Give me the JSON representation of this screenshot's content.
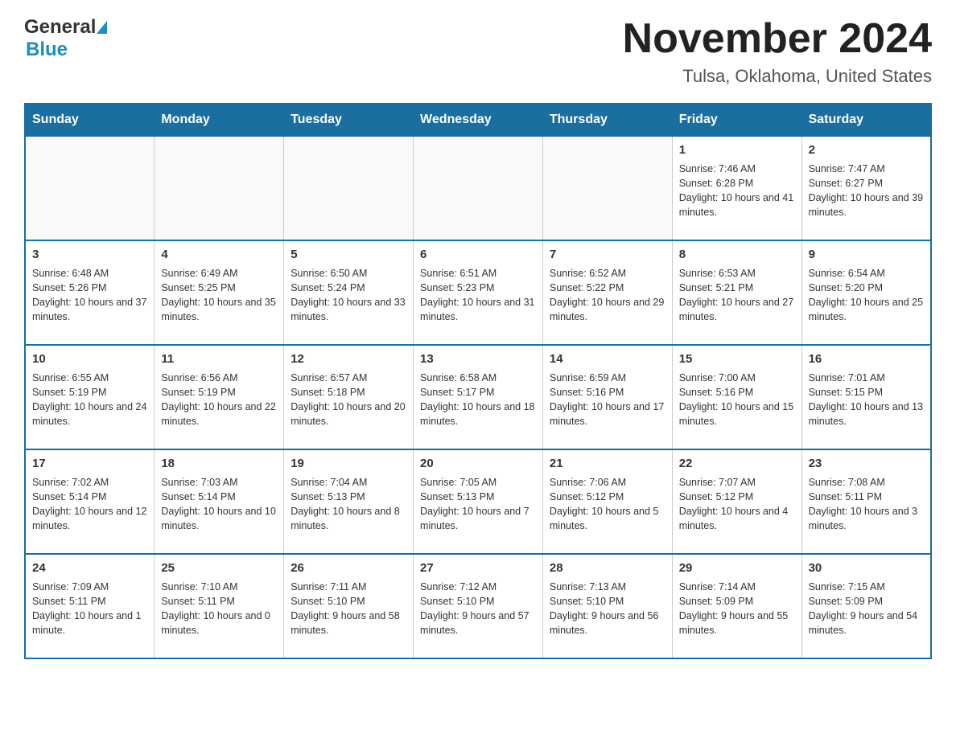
{
  "logo": {
    "general": "General",
    "blue": "Blue"
  },
  "title": "November 2024",
  "subtitle": "Tulsa, Oklahoma, United States",
  "weekdays": [
    "Sunday",
    "Monday",
    "Tuesday",
    "Wednesday",
    "Thursday",
    "Friday",
    "Saturday"
  ],
  "weeks": [
    [
      {
        "day": "",
        "info": ""
      },
      {
        "day": "",
        "info": ""
      },
      {
        "day": "",
        "info": ""
      },
      {
        "day": "",
        "info": ""
      },
      {
        "day": "",
        "info": ""
      },
      {
        "day": "1",
        "info": "Sunrise: 7:46 AM\nSunset: 6:28 PM\nDaylight: 10 hours and 41 minutes."
      },
      {
        "day": "2",
        "info": "Sunrise: 7:47 AM\nSunset: 6:27 PM\nDaylight: 10 hours and 39 minutes."
      }
    ],
    [
      {
        "day": "3",
        "info": "Sunrise: 6:48 AM\nSunset: 5:26 PM\nDaylight: 10 hours and 37 minutes."
      },
      {
        "day": "4",
        "info": "Sunrise: 6:49 AM\nSunset: 5:25 PM\nDaylight: 10 hours and 35 minutes."
      },
      {
        "day": "5",
        "info": "Sunrise: 6:50 AM\nSunset: 5:24 PM\nDaylight: 10 hours and 33 minutes."
      },
      {
        "day": "6",
        "info": "Sunrise: 6:51 AM\nSunset: 5:23 PM\nDaylight: 10 hours and 31 minutes."
      },
      {
        "day": "7",
        "info": "Sunrise: 6:52 AM\nSunset: 5:22 PM\nDaylight: 10 hours and 29 minutes."
      },
      {
        "day": "8",
        "info": "Sunrise: 6:53 AM\nSunset: 5:21 PM\nDaylight: 10 hours and 27 minutes."
      },
      {
        "day": "9",
        "info": "Sunrise: 6:54 AM\nSunset: 5:20 PM\nDaylight: 10 hours and 25 minutes."
      }
    ],
    [
      {
        "day": "10",
        "info": "Sunrise: 6:55 AM\nSunset: 5:19 PM\nDaylight: 10 hours and 24 minutes."
      },
      {
        "day": "11",
        "info": "Sunrise: 6:56 AM\nSunset: 5:19 PM\nDaylight: 10 hours and 22 minutes."
      },
      {
        "day": "12",
        "info": "Sunrise: 6:57 AM\nSunset: 5:18 PM\nDaylight: 10 hours and 20 minutes."
      },
      {
        "day": "13",
        "info": "Sunrise: 6:58 AM\nSunset: 5:17 PM\nDaylight: 10 hours and 18 minutes."
      },
      {
        "day": "14",
        "info": "Sunrise: 6:59 AM\nSunset: 5:16 PM\nDaylight: 10 hours and 17 minutes."
      },
      {
        "day": "15",
        "info": "Sunrise: 7:00 AM\nSunset: 5:16 PM\nDaylight: 10 hours and 15 minutes."
      },
      {
        "day": "16",
        "info": "Sunrise: 7:01 AM\nSunset: 5:15 PM\nDaylight: 10 hours and 13 minutes."
      }
    ],
    [
      {
        "day": "17",
        "info": "Sunrise: 7:02 AM\nSunset: 5:14 PM\nDaylight: 10 hours and 12 minutes."
      },
      {
        "day": "18",
        "info": "Sunrise: 7:03 AM\nSunset: 5:14 PM\nDaylight: 10 hours and 10 minutes."
      },
      {
        "day": "19",
        "info": "Sunrise: 7:04 AM\nSunset: 5:13 PM\nDaylight: 10 hours and 8 minutes."
      },
      {
        "day": "20",
        "info": "Sunrise: 7:05 AM\nSunset: 5:13 PM\nDaylight: 10 hours and 7 minutes."
      },
      {
        "day": "21",
        "info": "Sunrise: 7:06 AM\nSunset: 5:12 PM\nDaylight: 10 hours and 5 minutes."
      },
      {
        "day": "22",
        "info": "Sunrise: 7:07 AM\nSunset: 5:12 PM\nDaylight: 10 hours and 4 minutes."
      },
      {
        "day": "23",
        "info": "Sunrise: 7:08 AM\nSunset: 5:11 PM\nDaylight: 10 hours and 3 minutes."
      }
    ],
    [
      {
        "day": "24",
        "info": "Sunrise: 7:09 AM\nSunset: 5:11 PM\nDaylight: 10 hours and 1 minute."
      },
      {
        "day": "25",
        "info": "Sunrise: 7:10 AM\nSunset: 5:11 PM\nDaylight: 10 hours and 0 minutes."
      },
      {
        "day": "26",
        "info": "Sunrise: 7:11 AM\nSunset: 5:10 PM\nDaylight: 9 hours and 58 minutes."
      },
      {
        "day": "27",
        "info": "Sunrise: 7:12 AM\nSunset: 5:10 PM\nDaylight: 9 hours and 57 minutes."
      },
      {
        "day": "28",
        "info": "Sunrise: 7:13 AM\nSunset: 5:10 PM\nDaylight: 9 hours and 56 minutes."
      },
      {
        "day": "29",
        "info": "Sunrise: 7:14 AM\nSunset: 5:09 PM\nDaylight: 9 hours and 55 minutes."
      },
      {
        "day": "30",
        "info": "Sunrise: 7:15 AM\nSunset: 5:09 PM\nDaylight: 9 hours and 54 minutes."
      }
    ]
  ]
}
